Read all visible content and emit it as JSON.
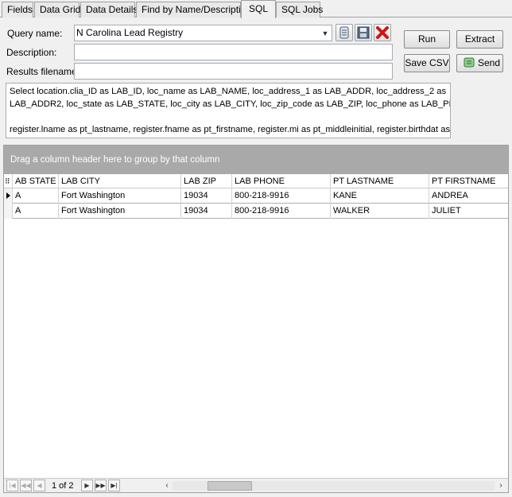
{
  "tabs": [
    {
      "label": "Fields"
    },
    {
      "label": "Data Grid"
    },
    {
      "label": "Data Details"
    },
    {
      "label": "Find by Name/Description"
    },
    {
      "label": "SQL"
    },
    {
      "label": "SQL Jobs"
    }
  ],
  "form": {
    "query_name_label": "Query name:",
    "query_name_value": "N Carolina Lead Registry",
    "description_label": "Description:",
    "description_value": "",
    "results_filename_label": "Results filename:",
    "results_filename_value": ""
  },
  "buttons": {
    "run": "Run",
    "extract": "Extract",
    "save_csv": "Save CSV",
    "send": "Send"
  },
  "sql_text": [
    "Select location.clia_ID as LAB_ID, loc_name as LAB_NAME, loc_address_1 as LAB_ADDR, loc_address_2 as",
    "LAB_ADDR2, loc_state as LAB_STATE,  loc_city as LAB_CITY, loc_zip_code as LAB_ZIP, loc_phone as LAB_PHONE,",
    "",
    "register.lname as pt_lastname, register.fname as pt_firstname, register.mi as pt_middleinitial, register.birthdat as"
  ],
  "grid": {
    "group_hint": "Drag a column header here to group by that column",
    "columns": [
      "AB STATE",
      "LAB CITY",
      "LAB ZIP",
      "LAB PHONE",
      "PT LASTNAME",
      "PT FIRSTNAME"
    ],
    "rows": [
      [
        "A",
        "Fort Washington",
        "19034",
        "800-218-9916",
        "KANE",
        "ANDREA"
      ],
      [
        "A",
        "Fort Washington",
        "19034",
        "800-218-9916",
        "WALKER",
        "JULIET"
      ]
    ],
    "pager_text": "1 of 2"
  }
}
